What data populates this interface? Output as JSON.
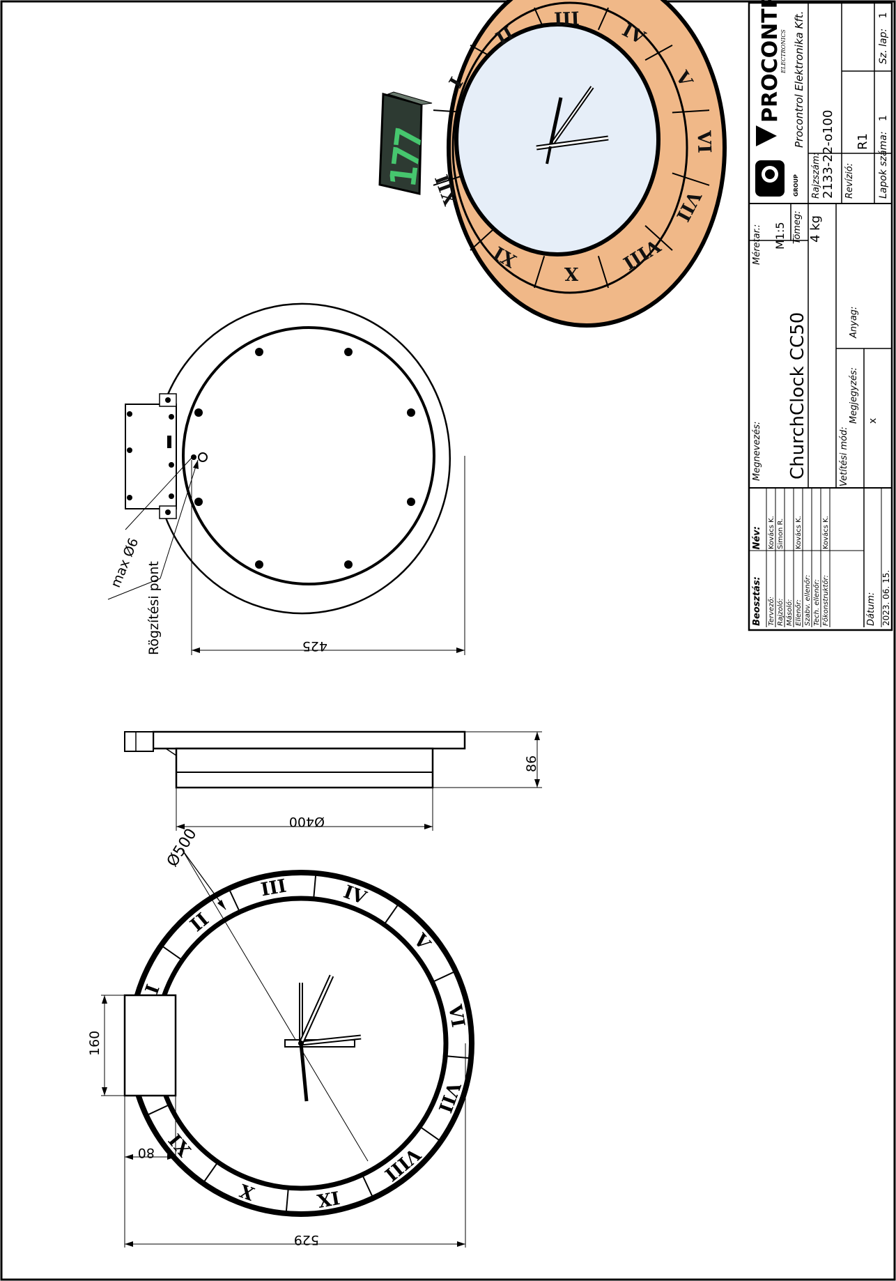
{
  "colors": {
    "line": "#000000",
    "ring_3d": "#f0b888",
    "face_3d": "#e6eef8",
    "display_digits": "#46c66e",
    "display_body": "#2d3a32"
  },
  "title_block": {
    "company_logo": "PROCONTROL",
    "company_logo_sub": "ELECTRONICS",
    "group_logo": "GROUP",
    "company_name": "Procontrol Elektronika Kft.",
    "meretarany_label": "Méretar.:",
    "meretarany_value": "M1:5",
    "tomeg_label": "Tömeg:",
    "tomeg_value": "4 kg",
    "rajzszam_label": "Rajzszám:",
    "rajzszam_value": "2133-22-o100",
    "revizio_label": "Revízió:",
    "revizio_value": "R1",
    "lapok_label": "Lapok száma:",
    "lapok_value": "1",
    "szlap_label": "Sz. lap:",
    "szlap_value": "1",
    "megnevezes_label": "Megnevezés:",
    "megnevezes_value": "ChurchClock CC50",
    "anyag_label": "Anyag:",
    "vetitesi_label": "Vetítési mód:",
    "megjegyzes_label": "Megjegyzés:",
    "megjegyzes_value": "x",
    "beosztas_label": "Beosztás:",
    "nev_label": "Név:",
    "roles": [
      {
        "role": "Tervező:",
        "name": "Kovács K."
      },
      {
        "role": "Rajzoló:",
        "name": "Simon R."
      },
      {
        "role": "Másoló:",
        "name": ""
      },
      {
        "role": "Ellenőr:",
        "name": "Kovács K."
      },
      {
        "role": "Szabv. ellenőr:",
        "name": ""
      },
      {
        "role": "Tech. ellenőr:",
        "name": ""
      },
      {
        "role": "Főkonstruktőr:",
        "name": "Kovács K."
      }
    ],
    "datum_label": "Dátum:",
    "datum_value": "2023. 06. 15."
  },
  "dimensions": {
    "d500": "Ø500",
    "h160": "160",
    "w80": "80",
    "w529": "529",
    "d400": "Ø400",
    "h86": "86",
    "w425": "425",
    "maxd6": "max Ø6",
    "rogzitesi_pont": "Rögzítési pont"
  },
  "numerals_front": [
    "I",
    "II",
    "III",
    "IV",
    "V",
    "VI",
    "VII",
    "VIII",
    "IX",
    "X",
    "XI"
  ],
  "numerals_iso": [
    "I",
    "II",
    "III",
    "IV",
    "V",
    "VI",
    "VII",
    "VIII",
    "X",
    "XI",
    "XII"
  ],
  "display_number": "177"
}
